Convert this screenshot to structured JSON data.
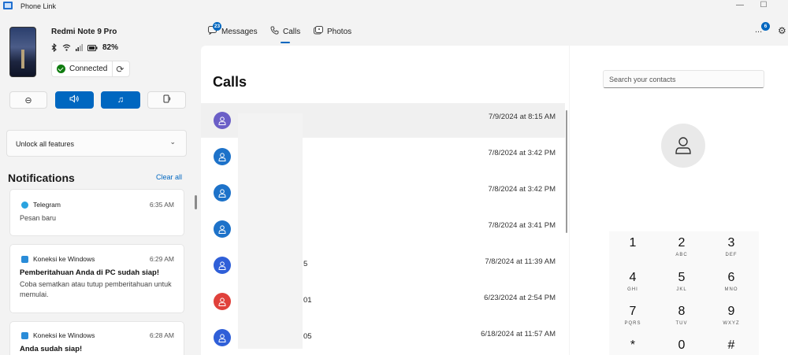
{
  "app": {
    "title": "Phone Link",
    "icon": "phone-link-app-icon"
  },
  "window_controls": {
    "minimize": "—",
    "maximize": "☐"
  },
  "device": {
    "name": "Redmi Note 9 Pro",
    "battery": "82%",
    "connection_label": "Connected",
    "icons": [
      "bluetooth-icon",
      "wifi-icon",
      "signal-icon",
      "battery-icon",
      "refresh-icon"
    ]
  },
  "quick_actions": [
    {
      "name": "do-not-disturb-button",
      "icon": "minus-circle-icon",
      "glyph": "⊖",
      "active": false
    },
    {
      "name": "sound-button",
      "icon": "speaker-icon",
      "glyph": "🔊",
      "active": true
    },
    {
      "name": "media-button",
      "icon": "music-note-icon",
      "glyph": "♫",
      "active": true
    },
    {
      "name": "audio-output-button",
      "icon": "speaker-device-icon",
      "glyph": "▯",
      "active": false
    }
  ],
  "unlock": {
    "label": "Unlock all features"
  },
  "notifications": {
    "title": "Notifications",
    "clear_all": "Clear all",
    "items": [
      {
        "app": "Telegram",
        "time": "6:35 AM",
        "heading": "",
        "body": "Pesan baru"
      },
      {
        "app": "Koneksi ke Windows",
        "time": "6:29 AM",
        "heading": "Pemberitahuan Anda di PC sudah siap!",
        "body": "Coba sematkan atau tutup pemberitahuan untuk memulai."
      },
      {
        "app": "Koneksi ke Windows",
        "time": "6:28 AM",
        "heading": "Anda sudah siap!",
        "body": ""
      }
    ]
  },
  "nav": {
    "tabs": [
      {
        "label": "Messages",
        "icon": "chat-icon",
        "badge": "23"
      },
      {
        "label": "Calls",
        "icon": "phone-icon",
        "active": true
      },
      {
        "label": "Photos",
        "icon": "photos-icon"
      }
    ],
    "more_badge": "6",
    "more_label": "...",
    "settings_icon": "gear-icon"
  },
  "calls": {
    "title": "Calls",
    "items": [
      {
        "name": "",
        "time": "7/9/2024 at 8:15 AM",
        "color": "#6b5fc7",
        "selected": true
      },
      {
        "name": "",
        "time": "7/8/2024 at 3:42 PM",
        "color": "#1d72c9"
      },
      {
        "name": "",
        "time": "7/8/2024 at 3:42 PM",
        "color": "#1d72c9"
      },
      {
        "name": "",
        "time": "7/8/2024 at 3:41 PM",
        "color": "#1d72c9"
      },
      {
        "name": "5",
        "time": "7/8/2024 at 11:39 AM",
        "color": "#2f5fd8"
      },
      {
        "name": "01",
        "time": "6/23/2024 at 2:54 PM",
        "color": "#e0413b"
      },
      {
        "name": "05",
        "time": "6/18/2024 at 11:57 AM",
        "color": "#2f5fd8"
      }
    ]
  },
  "dialer": {
    "search_placeholder": "Search your contacts",
    "keys": [
      {
        "digit": "1",
        "letters": ""
      },
      {
        "digit": "2",
        "letters": "ABC"
      },
      {
        "digit": "3",
        "letters": "DEF"
      },
      {
        "digit": "4",
        "letters": "GHI"
      },
      {
        "digit": "5",
        "letters": "JKL"
      },
      {
        "digit": "6",
        "letters": "MNO"
      },
      {
        "digit": "7",
        "letters": "PQRS"
      },
      {
        "digit": "8",
        "letters": "TUV"
      },
      {
        "digit": "9",
        "letters": "WXYZ"
      },
      {
        "digit": "*",
        "letters": ""
      },
      {
        "digit": "0",
        "letters": ""
      },
      {
        "digit": "#",
        "letters": ""
      }
    ]
  }
}
